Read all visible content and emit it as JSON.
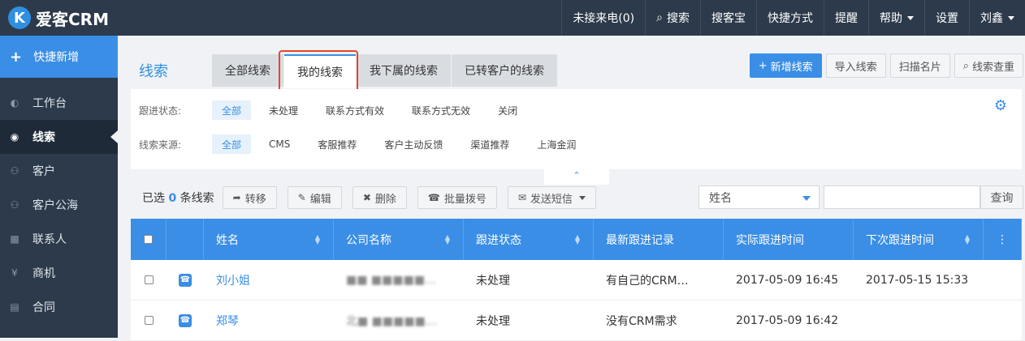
{
  "app": {
    "brand_letter": "K",
    "brand_name": "爱客CRM"
  },
  "topnav": {
    "missed_calls": "未接来电(0)",
    "search": "搜索",
    "soukebao": "搜客宝",
    "shortcuts": "快捷方式",
    "reminders": "提醒",
    "help": "帮助",
    "settings": "设置",
    "user": "刘鑫"
  },
  "sidebar": {
    "quick_add": "快捷新增",
    "items": [
      {
        "label": "工作台",
        "icon": "dashboard-icon"
      },
      {
        "label": "线索",
        "icon": "globe-icon"
      },
      {
        "label": "客户",
        "icon": "users-icon"
      },
      {
        "label": "客户公海",
        "icon": "users-icon"
      },
      {
        "label": "联系人",
        "icon": "chat-icon"
      },
      {
        "label": "商机",
        "icon": "yen-icon"
      },
      {
        "label": "合同",
        "icon": "document-icon"
      }
    ]
  },
  "page": {
    "title": "线索",
    "tabs": [
      "全部线索",
      "我的线索",
      "我下属的线索",
      "已转客户的线索"
    ],
    "active_tab": 1
  },
  "actions": {
    "new": "新增线索",
    "import": "导入线索",
    "scan": "扫描名片",
    "dedupe": "线索查重"
  },
  "filters": {
    "status_label": "跟进状态:",
    "status_options": [
      "全部",
      "未处理",
      "联系方式有效",
      "联系方式无效",
      "关闭"
    ],
    "source_label": "线索来源:",
    "source_options": [
      "全部",
      "CMS",
      "客服推荐",
      "客户主动反馈",
      "渠道推荐",
      "上海金润"
    ]
  },
  "toolbar": {
    "selected_prefix": "已选",
    "selected_count": "0",
    "selected_suffix": "条线索",
    "transfer": "转移",
    "edit": "编辑",
    "delete": "删除",
    "batch_call": "批量拨号",
    "send_sms": "发送短信",
    "search_field": "姓名",
    "search_button": "查询"
  },
  "table": {
    "columns": [
      "姓名",
      "公司名称",
      "跟进状态",
      "最新跟进记录",
      "实际跟进时间",
      "下次跟进时间"
    ],
    "rows": [
      {
        "name": "刘小姐",
        "company": "■■ ■■■■■…",
        "status": "未处理",
        "latest": "有自己的CRM…",
        "actual": "2017-05-09 16:45",
        "next": "2017-05-15 15:33"
      },
      {
        "name": "郑琴",
        "company": "北■ ■■■■■…",
        "status": "未处理",
        "latest": "没有CRM需求",
        "actual": "2017-05-09 16:42",
        "next": ""
      }
    ]
  },
  "colors": {
    "accent": "#3a8ee6",
    "nav_bg": "#2d3a4b",
    "highlight": "#e8452c"
  }
}
